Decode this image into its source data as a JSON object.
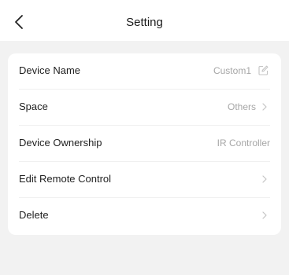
{
  "header": {
    "title": "Setting",
    "back_icon": "chevron-left-icon"
  },
  "settings": {
    "device_name": {
      "label": "Device Name",
      "value": "Custom1",
      "icon": "edit-icon"
    },
    "space": {
      "label": "Space",
      "value": "Others",
      "icon": "chevron-right-icon"
    },
    "device_ownership": {
      "label": "Device Ownership",
      "value": "IR Controller"
    },
    "edit_remote_control": {
      "label": "Edit Remote Control",
      "icon": "chevron-right-icon"
    },
    "delete": {
      "label": "Delete",
      "icon": "chevron-right-icon"
    }
  },
  "colors": {
    "background": "#f2f2f2",
    "card": "#ffffff",
    "primary_text": "#1f1f1f",
    "secondary_text": "#a6a6a6"
  }
}
